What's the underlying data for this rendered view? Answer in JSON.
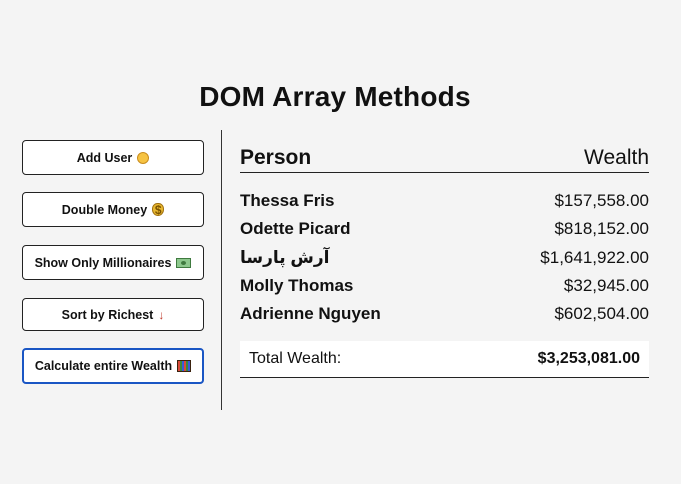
{
  "page": {
    "title": "DOM Array Methods"
  },
  "sidebar": {
    "buttons": [
      {
        "label": "Add User",
        "icon": "baby-face-icon"
      },
      {
        "label": "Double Money",
        "icon": "money-bag-icon"
      },
      {
        "label": "Show Only Millionaires",
        "icon": "dollar-bill-icon"
      },
      {
        "label": "Sort by Richest",
        "icon": "down-arrow-icon",
        "glyph": "↓"
      },
      {
        "label": "Calculate entire Wealth",
        "icon": "abacus-icon"
      }
    ]
  },
  "main": {
    "header": {
      "person": "Person",
      "wealth": "Wealth"
    },
    "rows": [
      {
        "name": "Thessa Fris",
        "money": "$157,558.00"
      },
      {
        "name": "Odette Picard",
        "money": "$818,152.00"
      },
      {
        "name": "آرش پارسا",
        "money": "$1,641,922.00"
      },
      {
        "name": "Molly Thomas",
        "money": "$32,945.00"
      },
      {
        "name": "Adrienne Nguyen",
        "money": "$602,504.00"
      }
    ],
    "total": {
      "label": "Total Wealth:",
      "amount": "$3,253,081.00"
    }
  },
  "colors": {
    "background": "#f4f4f4",
    "active_border": "#1a56c4",
    "text": "#111111"
  }
}
